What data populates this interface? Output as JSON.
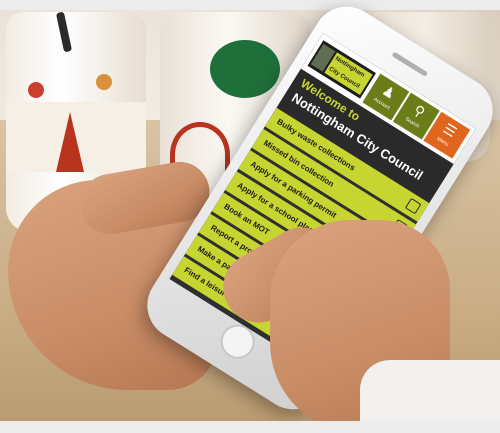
{
  "app": {
    "logo_line1": "Nottingham",
    "logo_line2": "City Council",
    "buttons": {
      "account": "Account",
      "search": "Search",
      "menu": "Menu"
    },
    "welcome_line1": "Welcome to",
    "welcome_line2": "Nottingham City Council",
    "menu_items": [
      "Bulky waste collections",
      "Missed bin collection",
      "Apply for a parking permit",
      "Apply for a school place",
      "Book an MOT",
      "Report a problem with a road",
      "Make a payment",
      "Find a leisure activity"
    ]
  },
  "icons": {
    "account": "person-icon",
    "search": "search-icon",
    "menu": "hamburger-icon"
  },
  "colors": {
    "accent_green": "#c7d530",
    "header_green": "#6b7d19",
    "menu_orange": "#e0651d"
  }
}
